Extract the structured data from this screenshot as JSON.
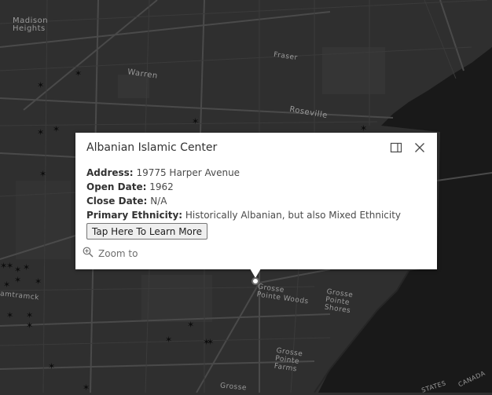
{
  "map": {
    "labels": [
      {
        "id": "madison-heights",
        "text": "Madison\nHeights"
      },
      {
        "id": "warren",
        "text": "Warren"
      },
      {
        "id": "fraser",
        "text": "Fraser"
      },
      {
        "id": "roseville",
        "text": "Roseville"
      },
      {
        "id": "hamtramck",
        "text": "amtramck"
      },
      {
        "id": "grosse-pointe-woods",
        "text": "Grosse\nPointe Woods"
      },
      {
        "id": "grosse-pointe-shores",
        "text": "Grosse\nPointe\nShores"
      },
      {
        "id": "grosse-pointe-farms",
        "text": "Grosse\nPointe\nFarms"
      },
      {
        "id": "grosse-bottom",
        "text": "Grosse"
      },
      {
        "id": "canada",
        "text": "CANADA"
      },
      {
        "id": "states",
        "text": "STATES"
      }
    ]
  },
  "popup": {
    "title": "Albanian Islamic Center",
    "fields": [
      {
        "label": "Address:",
        "value": "19775 Harper Avenue"
      },
      {
        "label": "Open Date:",
        "value": "1962"
      },
      {
        "label": "Close Date:",
        "value": "N/A"
      },
      {
        "label": "Primary Ethnicity:",
        "value": "Historically Albanian, but also Mixed Ethnicity"
      }
    ],
    "learn_more_label": "Tap Here To Learn More",
    "zoom_label": "Zoom to",
    "icons": {
      "dock": "dock-icon",
      "close": "close-icon",
      "zoom": "zoom-in-icon"
    }
  },
  "colors": {
    "land": "#2f2f2f",
    "water": "#191919",
    "road": "#4a4a4a",
    "marker": "#0d0d0d"
  }
}
